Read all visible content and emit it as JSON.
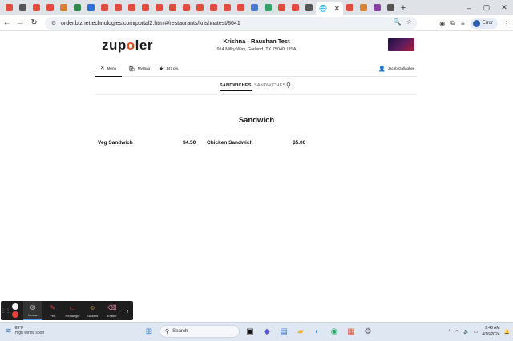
{
  "browser": {
    "url": "order.biznettechnologies.com/portal2.html#/restaurants/krishnatest/8641",
    "profile_status": "Error",
    "tab_colors": [
      "#e24c3c",
      "#555555",
      "#e24c3c",
      "#e24c3c",
      "#d9822b",
      "#2f8a4c",
      "#2f6bd6",
      "#e24c3c",
      "#e24c3c",
      "#e24c3c",
      "#e24c3c",
      "#e24c3c",
      "#e24c3c",
      "#e24c3c",
      "#e24c3c",
      "#e24c3c",
      "#e24c3c",
      "#e24c3c",
      "#4a7bd0",
      "#2fa56a",
      "#e24c3c",
      "#e24c3c",
      "#555555"
    ],
    "window_controls": [
      "–",
      "▢",
      "✕"
    ]
  },
  "header": {
    "logo_prefix": "zup",
    "logo_o": "o",
    "logo_suffix": "ler",
    "restaurant_name": "Krishna - Raushan Test",
    "restaurant_address": "914 Milky Way, Garland, TX 75040, USA"
  },
  "nav": {
    "menu_label": "Menu",
    "bag_label": "My Bag",
    "points_label": "147 pts.",
    "user_name": "Jacob Gallagher"
  },
  "category_tabs": [
    "SANDWICHES",
    "SANDWICHES"
  ],
  "section": {
    "title": "Sandwich",
    "items": [
      {
        "name": "Veg Sandwich",
        "price": "$4.50"
      },
      {
        "name": "Chicken Sandwich",
        "price": "$5.00"
      }
    ]
  },
  "recorder": {
    "tools": [
      "Mouse",
      "Pen",
      "Rectangle",
      "Stickers",
      "Eraser"
    ]
  },
  "taskbar": {
    "temperature": "63°F",
    "weather_desc": "High winds soon",
    "search_placeholder": "Search",
    "time": "9:48 AM",
    "date": "4/16/2024"
  }
}
